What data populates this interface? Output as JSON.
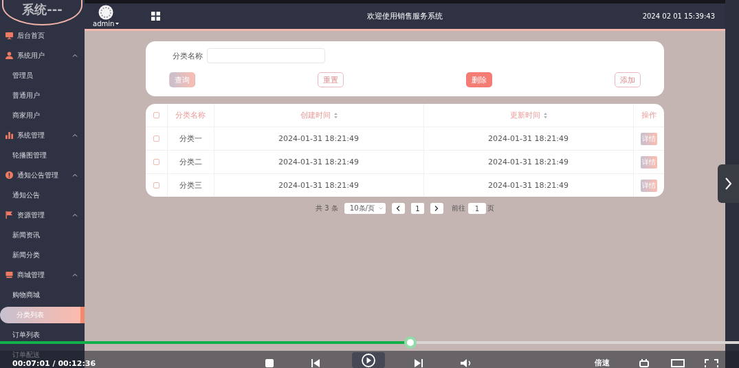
{
  "sidebar": {
    "logo_text": "系统---",
    "groups": [
      {
        "label": "后台首页"
      },
      {
        "label": "系统用户",
        "expanded": true,
        "children": [
          {
            "label": "管理员",
            "selected": false
          },
          {
            "label": "普通用户",
            "selected": false
          },
          {
            "label": "商家用户",
            "selected": false
          }
        ]
      },
      {
        "label": "系统管理",
        "expanded": true,
        "children": [
          {
            "label": "轮播图管理",
            "selected": false
          }
        ]
      },
      {
        "label": "通知公告管理",
        "expanded": true,
        "children": [
          {
            "label": "通知公告",
            "selected": false
          }
        ]
      },
      {
        "label": "资源管理",
        "expanded": true,
        "children": [
          {
            "label": "新闻资讯",
            "selected": false
          },
          {
            "label": "新闻分类",
            "selected": false
          }
        ]
      },
      {
        "label": "商城管理",
        "expanded": true,
        "children": [
          {
            "label": "购物商城",
            "selected": false
          },
          {
            "label": "分类列表",
            "selected": true
          },
          {
            "label": "订单列表",
            "selected": false
          },
          {
            "label": "订单配送",
            "selected": false
          }
        ]
      }
    ]
  },
  "header": {
    "user": "admin",
    "title": "欢迎使用销售服务系统",
    "datetime": "2024 02 01 15:39:43"
  },
  "search": {
    "label": "分类名称",
    "buttons": [
      {
        "label": "查询",
        "kind": "gradient"
      },
      {
        "label": "重置",
        "kind": "outline"
      },
      {
        "label": "删除",
        "kind": "danger"
      },
      {
        "label": "添加",
        "kind": "outline"
      }
    ]
  },
  "table": {
    "columns": [
      {
        "label": "分类名称",
        "sortable": false
      },
      {
        "label": "创建时间",
        "sortable": true
      },
      {
        "label": "更新时间",
        "sortable": true
      },
      {
        "label": "操作",
        "sortable": false
      }
    ],
    "all_checked": false,
    "rows": [
      {
        "checked": false,
        "cells": [
          "分类一",
          "2024-01-31 18:21:49",
          "2024-01-31 18:21:49"
        ],
        "action": "详情"
      },
      {
        "checked": false,
        "cells": [
          "分类二",
          "2024-01-31 18:21:49",
          "2024-01-31 18:21:49"
        ],
        "action": "详情"
      },
      {
        "checked": false,
        "cells": [
          "分类三",
          "2024-01-31 18:21:49",
          "2024-01-31 18:21:49"
        ],
        "action": "详情"
      }
    ]
  },
  "pagination": {
    "total": "共 3 条",
    "page_size": "10条/页",
    "current_page": "1",
    "goto_label": "前往",
    "goto_value": "1",
    "page_unit": "页"
  },
  "player": {
    "progress": {
      "level": 0.555
    },
    "time": "00:07:01 / 00:12:36",
    "speed_label": "倍速"
  }
}
